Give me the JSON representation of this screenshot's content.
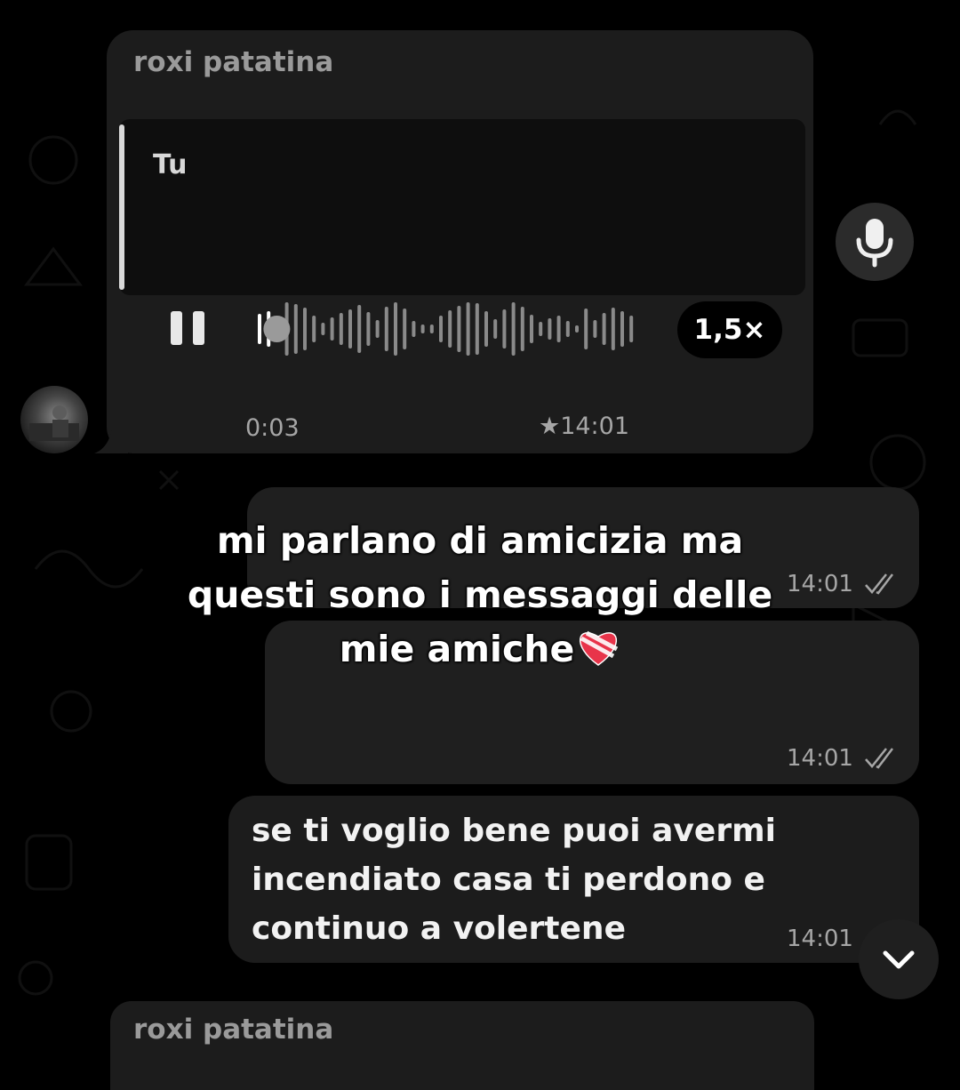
{
  "voice_message": {
    "sender": "roxi patatina",
    "quoted_author": "Tu",
    "speed": "1,5×",
    "duration": "0:03",
    "time": "★14:01",
    "playback_state": "playing",
    "progress": 0.02
  },
  "messages": [
    {
      "direction": "outgoing",
      "text": "",
      "time": "14:01",
      "status": "read"
    },
    {
      "direction": "outgoing",
      "text": "",
      "time": "14:01",
      "status": "read"
    },
    {
      "direction": "incoming",
      "text_lines": [
        "se ti voglio bene puoi avermi",
        "incendiato casa ti perdono e",
        "continuo a volertene"
      ],
      "time": "14:01"
    },
    {
      "direction": "incoming",
      "sender": "roxi patatina",
      "text": ""
    }
  ],
  "overlay_caption": {
    "lines": [
      "mi parlano di amicizia ma",
      "questi sono i messaggi delle",
      "mie amiche"
    ],
    "emoji": "heart-with-bandage"
  },
  "icons": {
    "mic": "microphone-icon",
    "scroll": "chevron-down-icon",
    "pause": "pause-icon",
    "read": "double-check-icon"
  },
  "colors": {
    "background": "#000000",
    "bubble": "#1f1f1f",
    "meta_text": "#a6a6a6",
    "heart": "#e8344a"
  }
}
